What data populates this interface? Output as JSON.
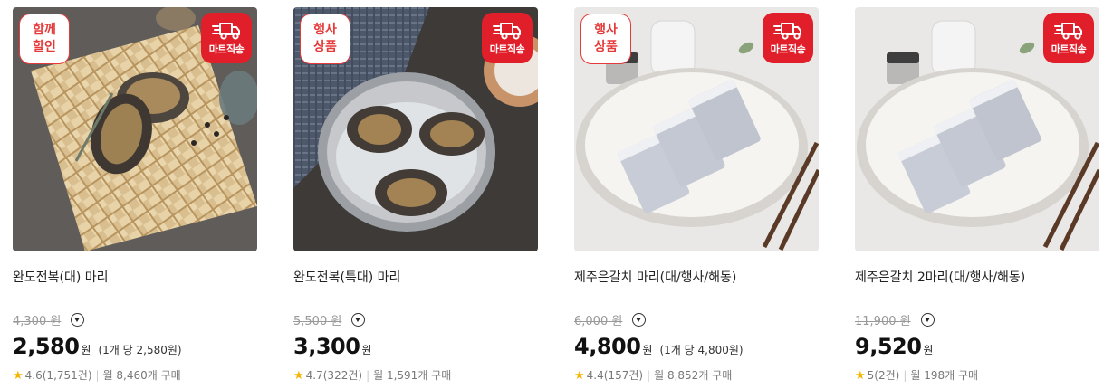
{
  "products": [
    {
      "badge_left_lines": [
        "함께",
        "할인"
      ],
      "badge_right_label": "마트직송",
      "badge_right_icon": "delivery-truck-icon",
      "title": "완도전복(대) 마리",
      "original_price": "4,300",
      "original_unit": "원",
      "sale_price": "2,580",
      "sale_unit": "원",
      "unit_price": "(1개 당 2,580원)",
      "rating": "4.6",
      "review_count": "(1,751건)",
      "monthly": "월 8,460개 구매",
      "image": "abalone-on-bamboo-tray"
    },
    {
      "badge_left_lines": [
        "행사",
        "상품"
      ],
      "badge_right_label": "마트직송",
      "badge_right_icon": "delivery-truck-icon",
      "title": "완도전복(특대) 마리",
      "original_price": "5,500",
      "original_unit": "원",
      "sale_price": "3,300",
      "sale_unit": "원",
      "unit_price": "",
      "rating": "4.7",
      "review_count": "(322건)",
      "monthly": "월 1,591개 구매",
      "image": "abalone-in-steel-bowl"
    },
    {
      "badge_left_lines": [
        "행사",
        "상품"
      ],
      "badge_right_label": "마트직송",
      "badge_right_icon": "delivery-truck-icon",
      "title": "제주은갈치 마리(대/행사/해동)",
      "original_price": "6,000",
      "original_unit": "원",
      "sale_price": "4,800",
      "sale_unit": "원",
      "unit_price": "(1개 당 4,800원)",
      "rating": "4.4",
      "review_count": "(157건)",
      "monthly": "월 8,852개 구매",
      "image": "hairtail-on-plate"
    },
    {
      "badge_left_lines": [],
      "badge_right_label": "마트직송",
      "badge_right_icon": "delivery-truck-icon",
      "title": "제주은갈치 2마리(대/행사/해동)",
      "original_price": "11,900",
      "original_unit": "원",
      "sale_price": "9,520",
      "sale_unit": "원",
      "unit_price": "",
      "rating": "5",
      "review_count": "(2건)",
      "monthly": "월 198개 구매",
      "image": "hairtail-on-plate"
    }
  ],
  "colors": {
    "badge_red": "#e11f2a",
    "star": "#f5b400",
    "strike_gray": "#999999"
  }
}
